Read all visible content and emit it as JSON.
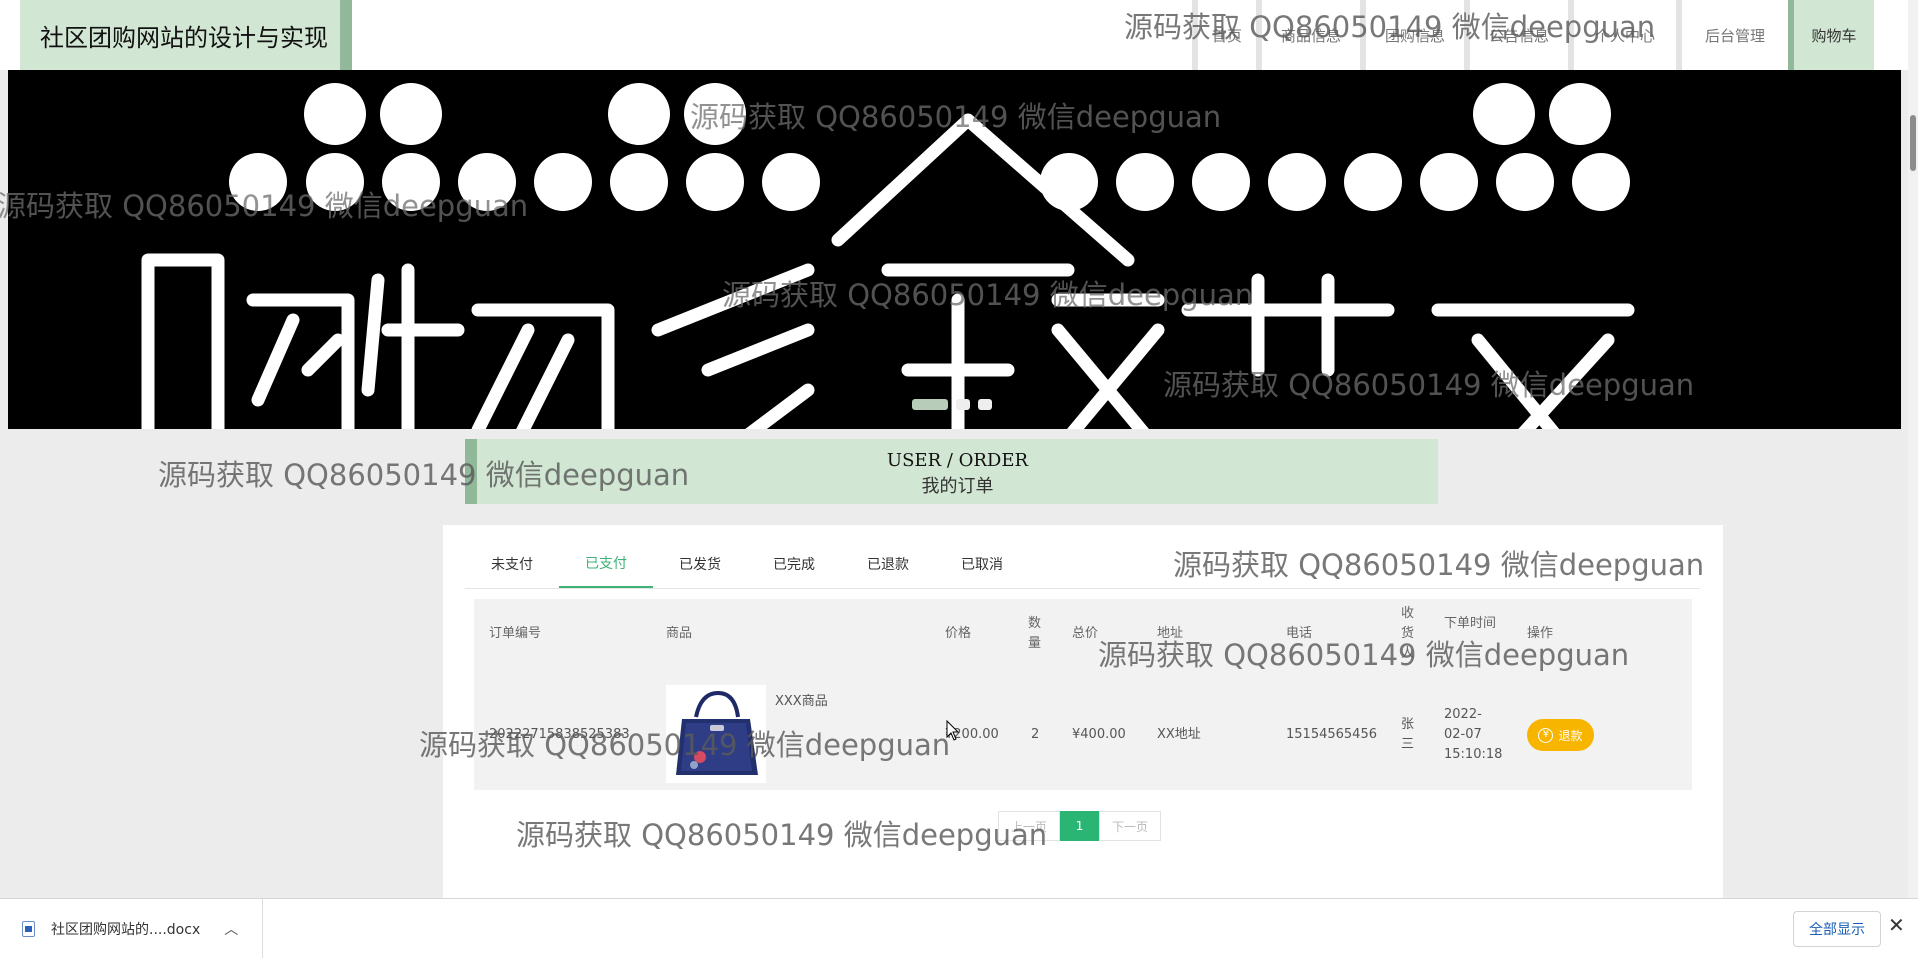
{
  "header": {
    "site_title": "社区团购网站的设计与实现",
    "nav": [
      {
        "label": "首页"
      },
      {
        "label": "商品信息"
      },
      {
        "label": "团购信息"
      },
      {
        "label": "公告信息"
      },
      {
        "label": "个人中心"
      },
      {
        "label": "后台管理"
      },
      {
        "label": "购物车"
      }
    ]
  },
  "banner": {
    "slides_count": 3,
    "active_slide": 1,
    "graphic_text": "购物狂欢节"
  },
  "section": {
    "en": "USER / ORDER",
    "cn": "我的订单"
  },
  "orders": {
    "tabs": [
      {
        "label": "未支付"
      },
      {
        "label": "已支付"
      },
      {
        "label": "已发货"
      },
      {
        "label": "已完成"
      },
      {
        "label": "已退款"
      },
      {
        "label": "已取消"
      }
    ],
    "active_tab": "已支付",
    "columns": {
      "order_no": "订单编号",
      "product": "商品",
      "price": "价格",
      "qty": "数量",
      "total": "总价",
      "address": "地址",
      "phone": "电话",
      "receiver": "收货人",
      "time": "下单时间",
      "action": "操作"
    },
    "rows": [
      {
        "order_no": "20222715838525383",
        "product_name": "XXX商品",
        "price": "¥200.00",
        "qty": "2",
        "total": "¥400.00",
        "address": "XX地址",
        "phone": "15154565456",
        "receiver": "张三",
        "time": "2022-02-07 15:10:18",
        "action_label": "退款"
      }
    ],
    "pager": {
      "prev": "上一页",
      "current": "1",
      "next": "下一页"
    }
  },
  "download_bar": {
    "file_name": "社区团购网站的....docx",
    "show_all": "全部显示"
  },
  "watermark": "源码获取 QQ86050149 微信deepguan",
  "colors": {
    "accent_green": "#3eb277",
    "header_green": "#d2e7d3",
    "border_green": "#92b89a",
    "refund_orange": "#f7b500"
  }
}
